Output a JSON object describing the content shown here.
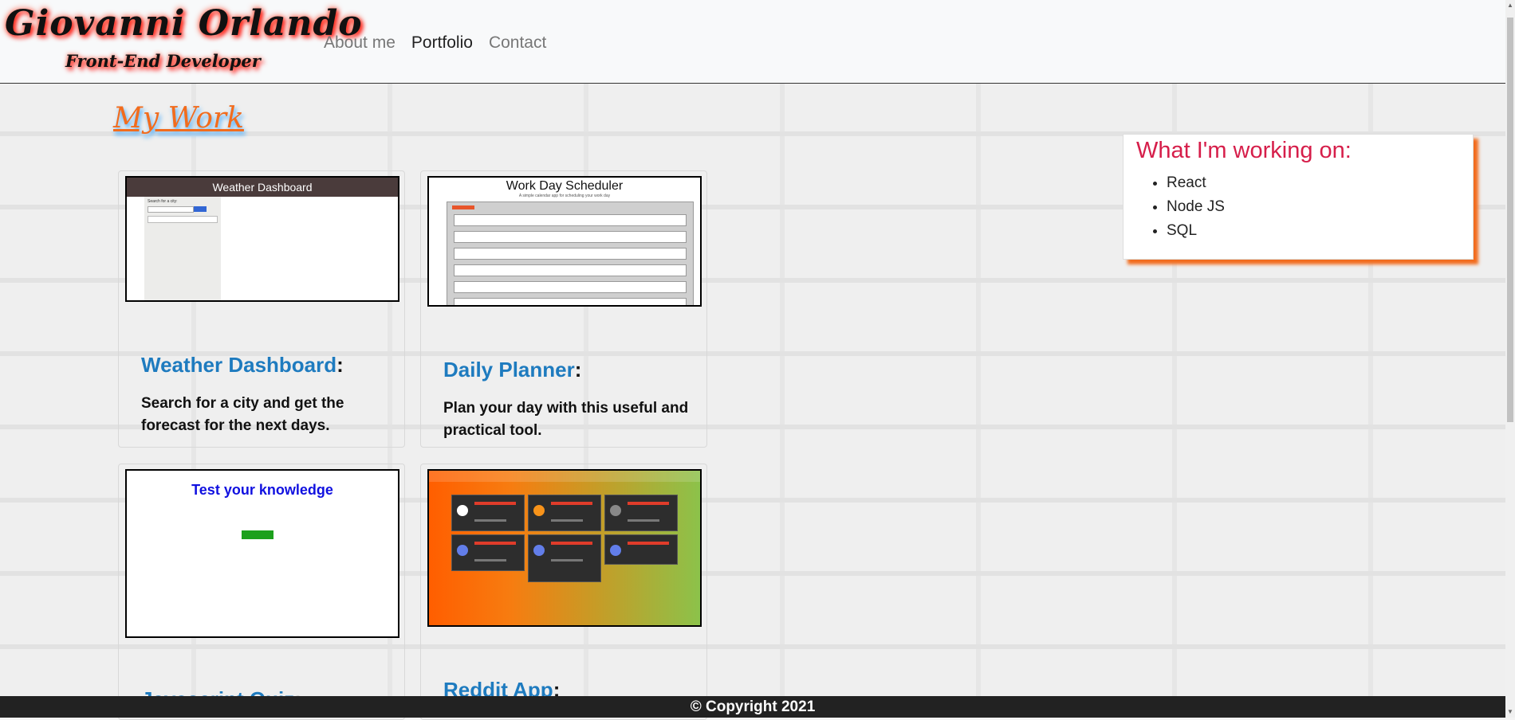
{
  "brand": {
    "name": "Giovanni Orlando",
    "role": "Front-End Developer"
  },
  "nav": {
    "items": [
      {
        "label": "About me",
        "active": false
      },
      {
        "label": "Portfolio",
        "active": true
      },
      {
        "label": "Contact",
        "active": false
      }
    ]
  },
  "section": {
    "title": "My Work"
  },
  "projects": [
    {
      "title": "Weather Dashboard",
      "description": "Search for a city and get the forecast for the next days.",
      "thumb": {
        "header": "Weather Dashboard",
        "label": "Search for a city:"
      }
    },
    {
      "title": "Daily Planner",
      "description": "Plan your day with this useful and practical tool.",
      "thumb": {
        "header": "Work Day Scheduler",
        "subheader": "A simple calendar app for scheduling your work day"
      }
    },
    {
      "title": "Javascript Quiz",
      "description": "",
      "thumb": {
        "header": "Test your knowledge"
      }
    },
    {
      "title": "Reddit App",
      "description": "",
      "thumb": {
        "header": ""
      }
    }
  ],
  "aside": {
    "title": "What I'm working on:",
    "items": [
      "React",
      "Node JS",
      "SQL"
    ]
  },
  "footer": {
    "text": "© Copyright 2021"
  },
  "colors": {
    "accent": "#f26c1d",
    "link": "#1e7bbf",
    "aside_title": "#d61e4a",
    "footer_bg": "#222222"
  }
}
